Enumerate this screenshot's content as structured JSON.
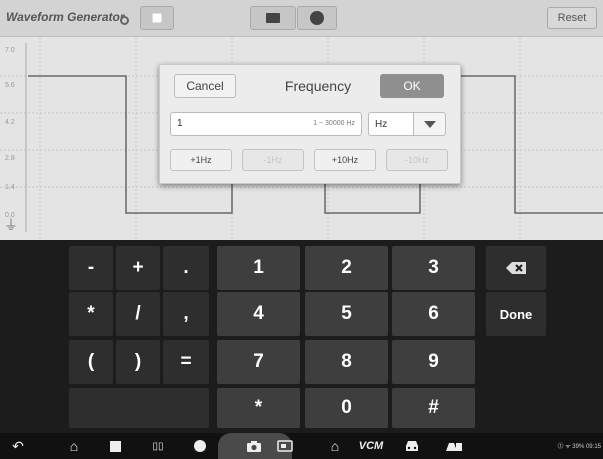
{
  "app": {
    "title": "Waveform Generator"
  },
  "toolbar": {
    "reset_label": "Reset"
  },
  "plot": {
    "y_ticks": [
      "7.0",
      "5.6",
      "4.2",
      "2.8",
      "1.4",
      "0.0"
    ]
  },
  "dialog": {
    "cancel_label": "Cancel",
    "title": "Frequency",
    "ok_label": "OK",
    "input_value": "1",
    "range_hint": "1 ~ 30000 Hz",
    "unit": "Hz",
    "steps": [
      "+1Hz",
      "-1Hz",
      "+10Hz",
      "-10Hz"
    ]
  },
  "keyboard": {
    "row1": [
      "-",
      "+",
      ".",
      "1",
      "2",
      "3"
    ],
    "row2": [
      "*",
      "/",
      ",",
      "4",
      "5",
      "6"
    ],
    "row3": [
      "(",
      ")",
      "=",
      "7",
      "8",
      "9"
    ],
    "row4": [
      "*",
      "0",
      "#"
    ],
    "done_label": "Done",
    "backspace_icon": "backspace-icon"
  },
  "navbar": {
    "icons": [
      "back-icon",
      "home-icon",
      "recent-apps-icon",
      "split-screen-icon",
      "browser-icon",
      "camera-icon",
      "screen-record-icon",
      "maxifix-icon",
      "vcm-icon",
      "car-icon",
      "shop-icon"
    ],
    "vcm_label": "VCM",
    "status_text": "⓵ ᯤ 39% 09:15"
  },
  "colors": {
    "ok_button": "#8f8f8f",
    "keyboard_bg": "#1c1c1c",
    "key_bg": "#2e2e2e",
    "numkey_bg": "#3e3e3e"
  }
}
